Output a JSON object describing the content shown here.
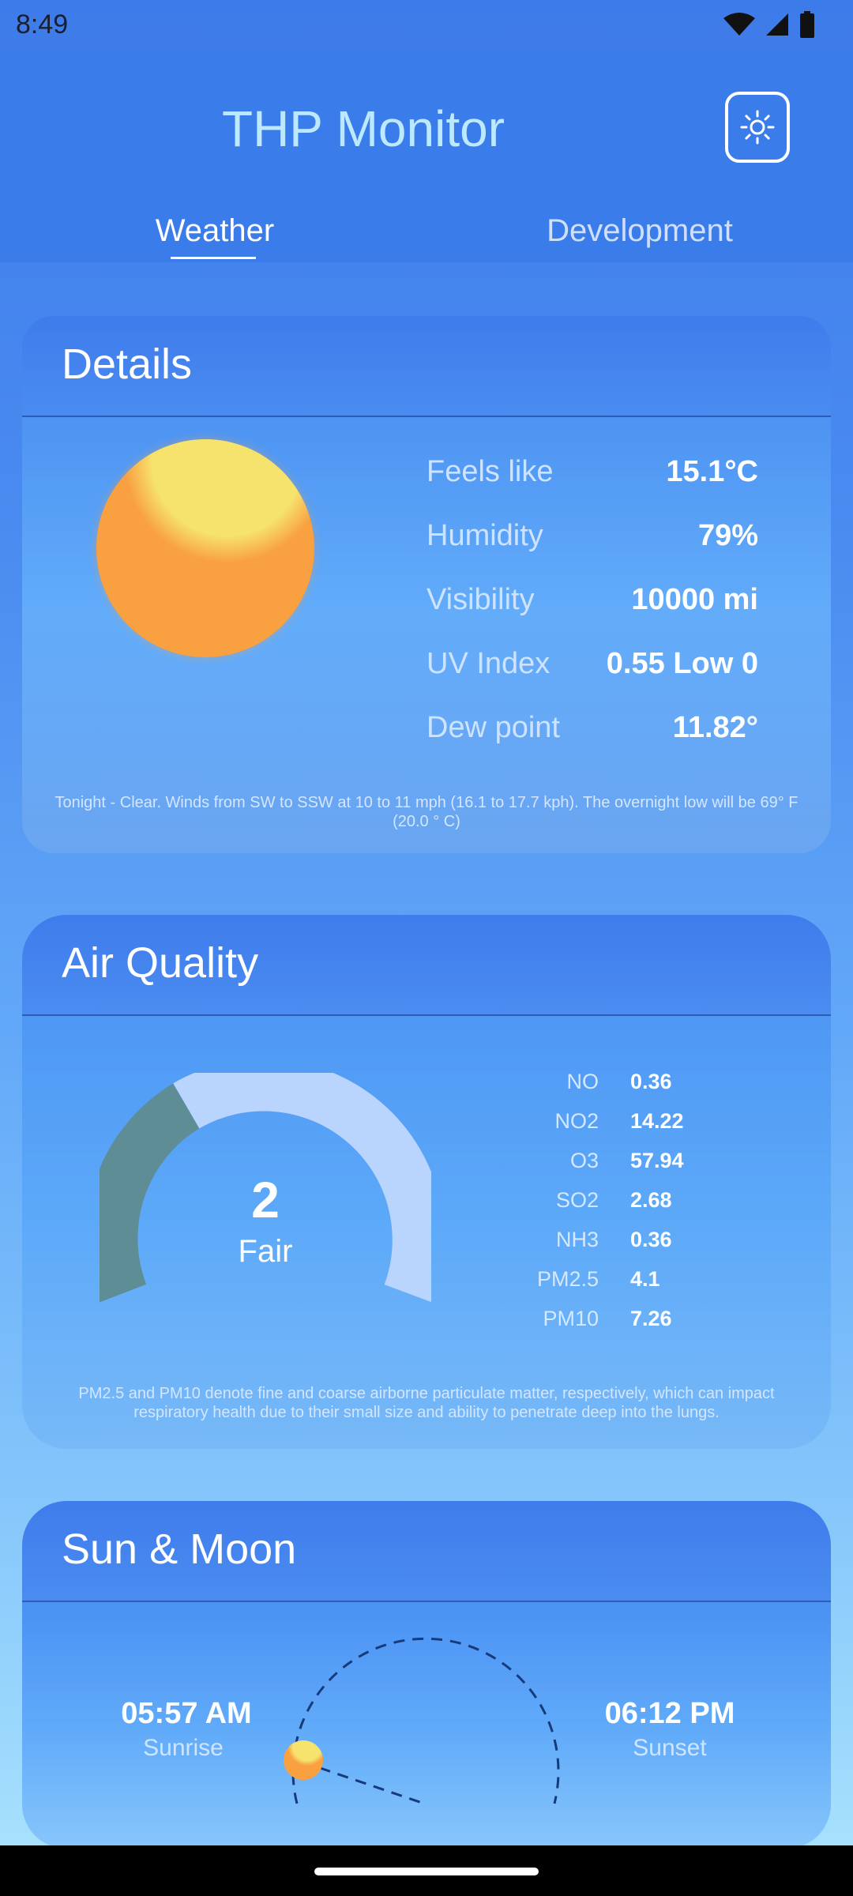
{
  "status_bar": {
    "time": "8:49"
  },
  "app": {
    "title": "THP Monitor"
  },
  "tabs": [
    {
      "label": "Weather",
      "selected": true
    },
    {
      "label": "Development",
      "selected": false
    }
  ],
  "details": {
    "title": "Details",
    "metrics": [
      {
        "label": "Feels like",
        "value": "15.1°C"
      },
      {
        "label": "Humidity",
        "value": "79%"
      },
      {
        "label": "Visibility",
        "value": "10000 mi"
      },
      {
        "label": "UV Index",
        "value": "0.55 Low 0"
      },
      {
        "label": "Dew point",
        "value": "11.82°"
      }
    ],
    "note": "Tonight - Clear. Winds from SW to SSW at 10 to 11 mph (16.1 to 17.7 kph). The overnight low will be 69° F (20.0 ° C)"
  },
  "air_quality": {
    "title": "Air Quality",
    "index": "2",
    "label": "Fair",
    "pollutants": [
      {
        "name": "NO",
        "value": "0.36"
      },
      {
        "name": "NO2",
        "value": "14.22"
      },
      {
        "name": "O3",
        "value": "57.94"
      },
      {
        "name": "SO2",
        "value": "2.68"
      },
      {
        "name": "NH3",
        "value": "0.36"
      },
      {
        "name": "PM2.5",
        "value": "4.1"
      },
      {
        "name": "PM10",
        "value": "7.26"
      }
    ],
    "note": "PM2.5 and PM10 denote fine and coarse airborne particulate matter, respectively, which can impact respiratory health due to their small size and ability to penetrate deep into the lungs."
  },
  "sun_moon": {
    "title": "Sun & Moon",
    "sunrise_time": "05:57 AM",
    "sunrise_label": "Sunrise",
    "sunset_time": "06:12 PM",
    "sunset_label": "Sunset"
  },
  "colors": {
    "background": "#3e7bea",
    "gauge_fill": "#5e8d96",
    "gauge_track": "#b9d4fd",
    "sun_orange": "#f9a040",
    "sun_yellow": "#f6e36e"
  },
  "icons": {
    "theme_toggle": "sun-icon",
    "wifi": "wifi-icon",
    "signal": "signal-icon",
    "battery": "battery-icon"
  }
}
